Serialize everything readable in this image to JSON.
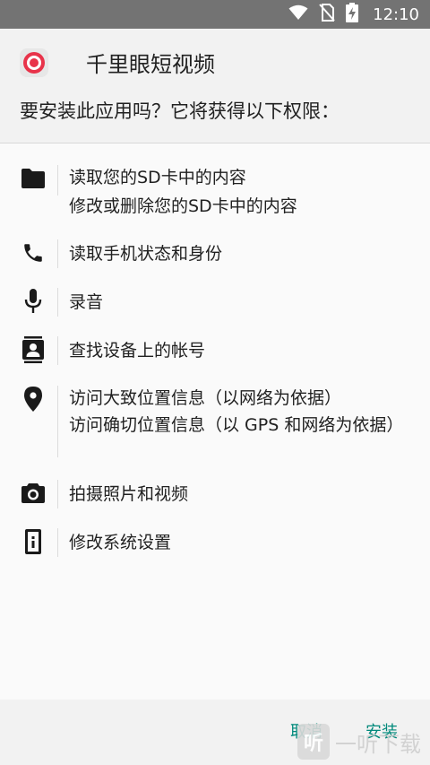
{
  "status_bar": {
    "time": "12:10",
    "icons": [
      "wifi-icon",
      "no-sim-icon",
      "battery-charging-icon"
    ]
  },
  "header": {
    "app_name": "千里眼短视频",
    "question": "要安装此应用吗？它将获得以下权限："
  },
  "permissions": [
    {
      "icon": "folder-icon",
      "lines": [
        "读取您的SD卡中的内容",
        "修改或删除您的SD卡中的内容"
      ]
    },
    {
      "icon": "phone-icon",
      "lines": [
        "读取手机状态和身份"
      ]
    },
    {
      "icon": "microphone-icon",
      "lines": [
        "录音"
      ]
    },
    {
      "icon": "contacts-icon",
      "lines": [
        "查找设备上的帐号"
      ]
    },
    {
      "icon": "location-icon",
      "lines": [
        "访问大致位置信息（以网络为依据）",
        "访问确切位置信息（以 GPS 和网络为依据）"
      ]
    },
    {
      "icon": "camera-icon",
      "lines": [
        "拍摄照片和视频"
      ]
    },
    {
      "icon": "system-settings-icon",
      "lines": [
        "修改系统设置"
      ]
    }
  ],
  "footer": {
    "cancel_label": "取消",
    "install_label": "安装",
    "watermark_text": "一听下载",
    "watermark_logo": "听"
  },
  "colors": {
    "accent": "#00897b",
    "status_bar": "#737373",
    "app_icon_red": "#e8334a"
  }
}
